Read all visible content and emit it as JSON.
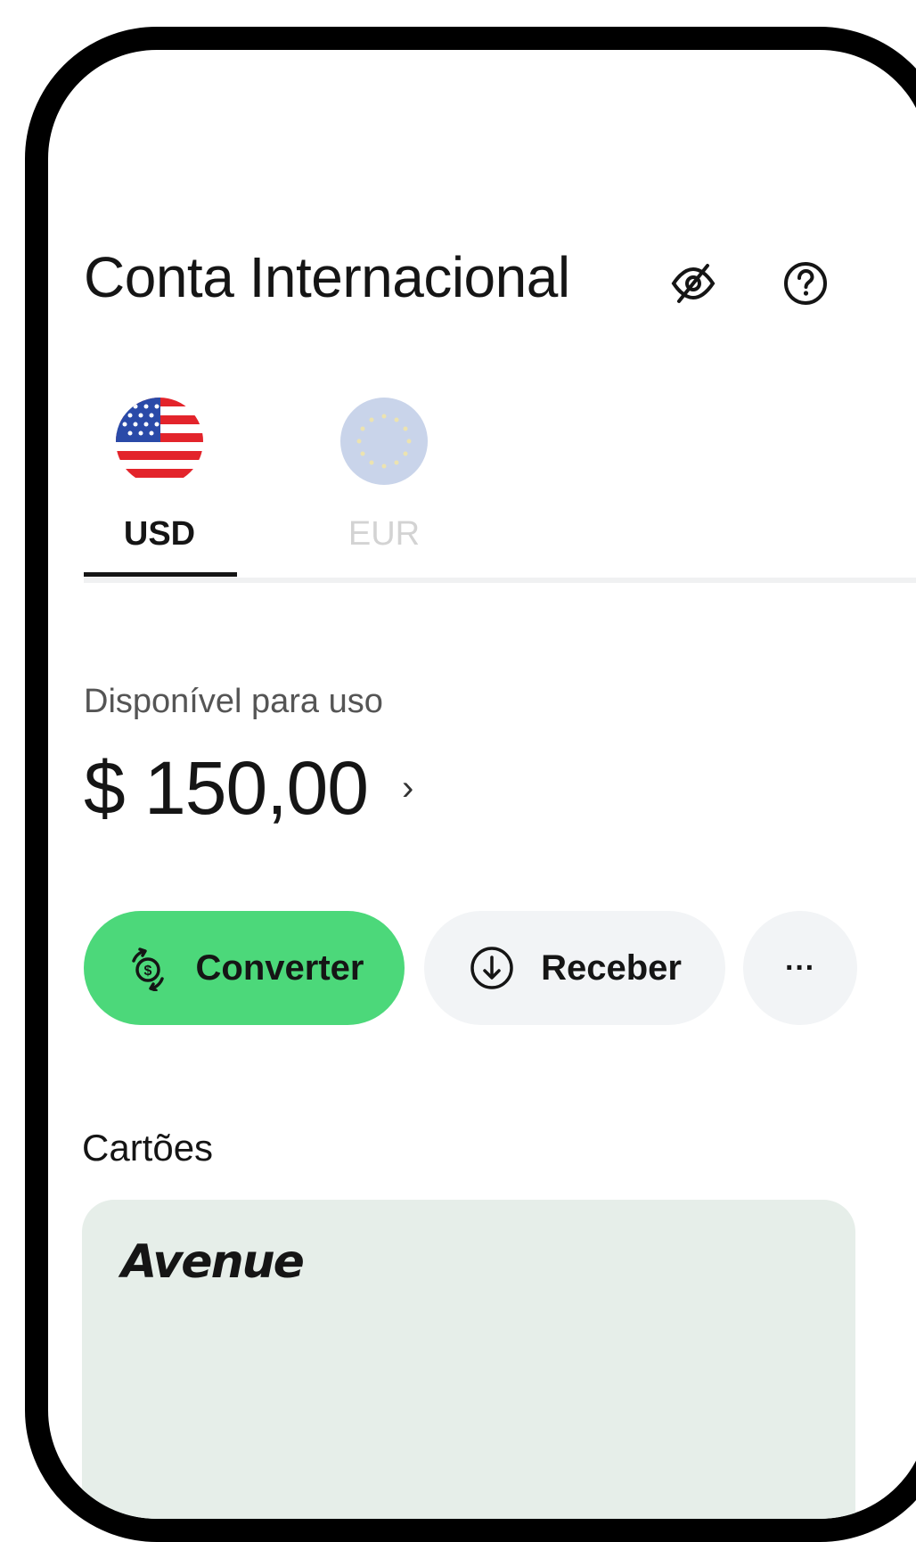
{
  "header": {
    "title": "Conta Internacional"
  },
  "icons": {
    "hide_balance": "eye-off-icon",
    "help": "help-circle-icon"
  },
  "tabs": [
    {
      "label": "USD",
      "active": true,
      "flag": "us-flag-icon"
    },
    {
      "label": "EUR",
      "active": false,
      "flag": "eu-flag-icon"
    }
  ],
  "balance": {
    "label": "Disponível para uso",
    "amount": "$ 150,00",
    "chevron": "›"
  },
  "actions": {
    "convert_label": "Converter",
    "receive_label": "Receber",
    "more_label": "···"
  },
  "cards": {
    "title": "Cartões",
    "card_brand": "Avenue"
  },
  "colors": {
    "accent": "#4cd87a",
    "button_bg": "#f2f4f6",
    "card_bg": "#e6eee9"
  }
}
